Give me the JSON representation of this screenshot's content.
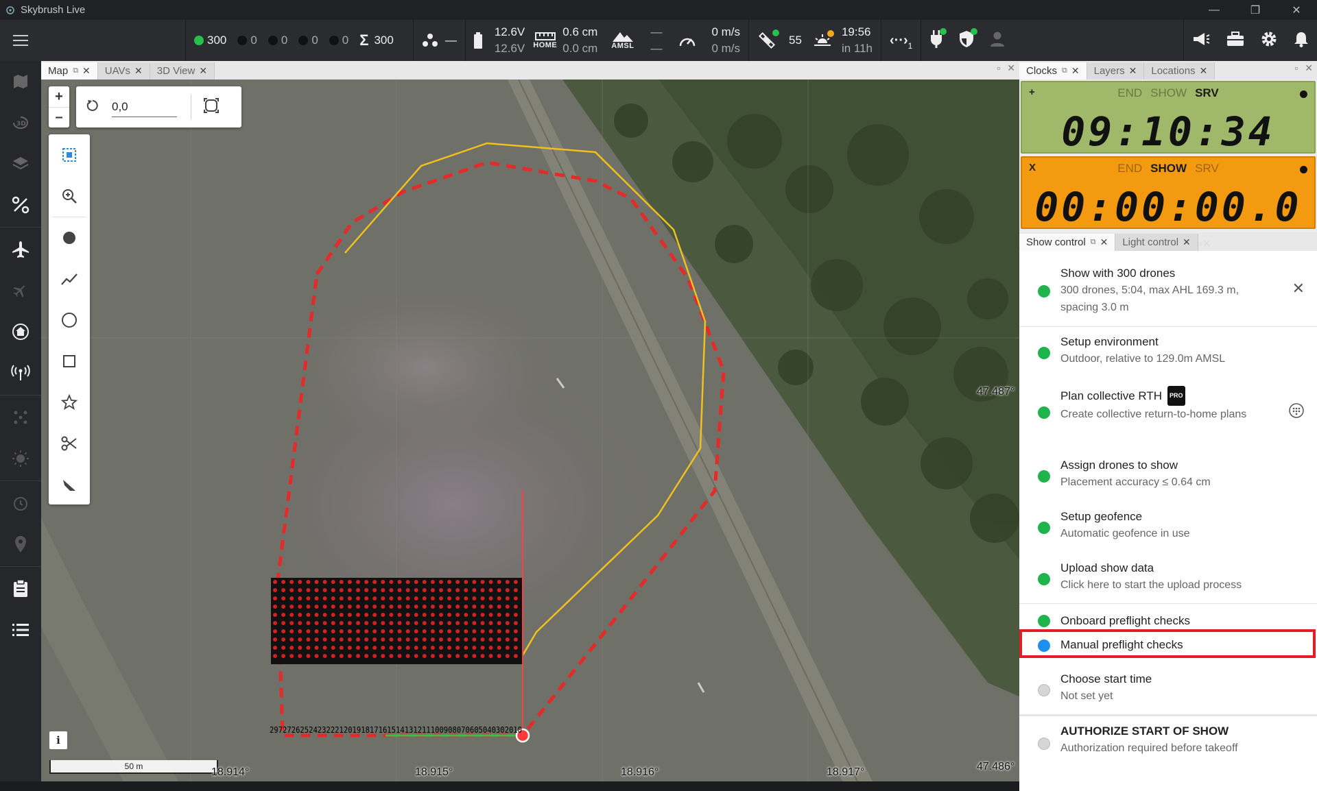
{
  "window": {
    "title": "Skybrush Live",
    "minimize": "—",
    "maximize": "❐",
    "close": "✕"
  },
  "header": {
    "uav_count_total": "300",
    "uav_counts_dim": [
      "0",
      "0",
      "0",
      "0"
    ],
    "sum_count": "300",
    "cluster_value": "—",
    "battery_top": "12.6V",
    "battery_bottom": "12.6V",
    "home_top": "0.6 cm",
    "home_bottom": "0.0 cm",
    "home_label": "HOME",
    "amsl_label": "AMSL",
    "amsl_top": "—",
    "amsl_bottom": "—",
    "speed_top": "0 m/s",
    "speed_bottom": "0 m/s",
    "satellite_count": "55",
    "sun_time": "19:56",
    "sun_sub": "in 11h",
    "rtk_sub": "1"
  },
  "map_panel": {
    "tabs": [
      {
        "label": "Map",
        "active": true
      },
      {
        "label": "UAVs",
        "active": false
      },
      {
        "label": "3D View",
        "active": false
      }
    ],
    "rotation_value": "0,0",
    "scale_label": "50 m",
    "info_label": "i",
    "coords": {
      "lon1": "18.914°",
      "lon2": "18.915°",
      "lon3": "18.916°",
      "lon4": "18.917°",
      "lat1": "47.487°",
      "lat2": "47.486°"
    },
    "drone_labels": "2972726252423222120191817161514131211100908070605040302010",
    "colors": {
      "geofence": "#e52a2a",
      "convex_hull": "#f0c020",
      "home_marker": "#ff3b3b"
    }
  },
  "right_top": {
    "tabs": [
      {
        "label": "Clocks",
        "active": true
      },
      {
        "label": "Layers",
        "active": false
      },
      {
        "label": "Locations",
        "active": false
      }
    ]
  },
  "clocks": [
    {
      "corner": "+",
      "modes": [
        "END",
        "SHOW",
        "SRV"
      ],
      "active_mode": "SRV",
      "time": "09:10:34",
      "color": "#a0b86a"
    },
    {
      "corner": "X",
      "modes": [
        "END",
        "SHOW",
        "SRV"
      ],
      "active_mode": "SHOW",
      "time": "00:00:00.0",
      "color": "#f39a10"
    }
  ],
  "show_panel": {
    "tabs": [
      {
        "label": "Show control",
        "active": true
      },
      {
        "label": "Light control",
        "active": false
      }
    ],
    "steps": [
      {
        "title": "Show with 300 drones",
        "subtitle": "300 drones, 5:04, max AHL 169.3 m, spacing 3.0 m",
        "status": "green"
      },
      {
        "title": "Setup environment",
        "subtitle": "Outdoor, relative to 129.0m AMSL",
        "status": "green"
      },
      {
        "title": "Plan collective RTH",
        "badge": "PRO",
        "subtitle": "Create collective return-to-home plans",
        "status": "green"
      },
      {
        "title": "Assign drones to show",
        "subtitle": "Placement accuracy ≤ 0.64 cm",
        "status": "green"
      },
      {
        "title": "Setup geofence",
        "subtitle": "Automatic geofence in use",
        "status": "green"
      },
      {
        "title": "Upload show data",
        "subtitle": "Click here to start the upload process",
        "status": "green"
      },
      {
        "title": "Onboard preflight checks",
        "subtitle": "",
        "status": "green"
      },
      {
        "title": "Manual preflight checks",
        "subtitle": "",
        "status": "blue",
        "highlighted": true
      },
      {
        "title": "Choose start time",
        "subtitle": "Not set yet",
        "status": "grey"
      },
      {
        "title": "AUTHORIZE START OF SHOW",
        "subtitle": "Authorization required before takeoff",
        "status": "grey"
      }
    ]
  }
}
